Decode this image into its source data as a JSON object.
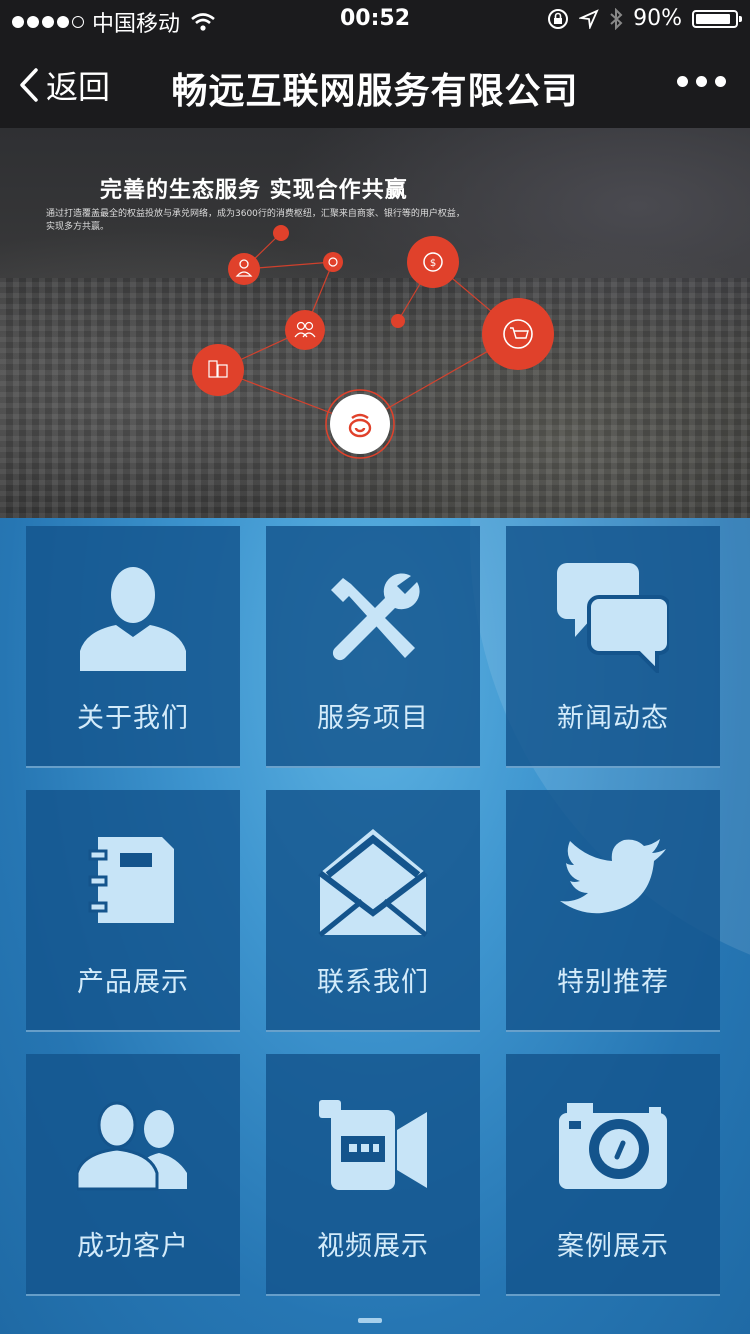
{
  "status_bar": {
    "carrier": "中国移动",
    "time": "00:52",
    "battery": "90%",
    "battery_level": 0.9
  },
  "nav": {
    "back_label": "返回",
    "title": "畅远互联网服务有限公司"
  },
  "banner": {
    "title": "完善的生态服务 实现合作共赢",
    "subtitle": "通过打造覆盖最全的权益投放与承兑网络，成为3600行的消费枢纽，汇聚来自商家、银行等的用户权益，实现多方共赢。"
  },
  "menu": [
    {
      "label": "关于我们",
      "icon": "user-icon"
    },
    {
      "label": "服务项目",
      "icon": "tools-icon"
    },
    {
      "label": "新闻动态",
      "icon": "chat-bubbles-icon"
    },
    {
      "label": "产品展示",
      "icon": "notebook-icon"
    },
    {
      "label": "联系我们",
      "icon": "envelope-icon"
    },
    {
      "label": "特别推荐",
      "icon": "bird-icon"
    },
    {
      "label": "成功客户",
      "icon": "users-icon"
    },
    {
      "label": "视频展示",
      "icon": "video-camera-icon"
    },
    {
      "label": "案例展示",
      "icon": "camera-icon"
    }
  ],
  "colors": {
    "accent_red": "#e0412b",
    "tile_blue": "#14548c",
    "label_color": "#d3ebfa"
  }
}
